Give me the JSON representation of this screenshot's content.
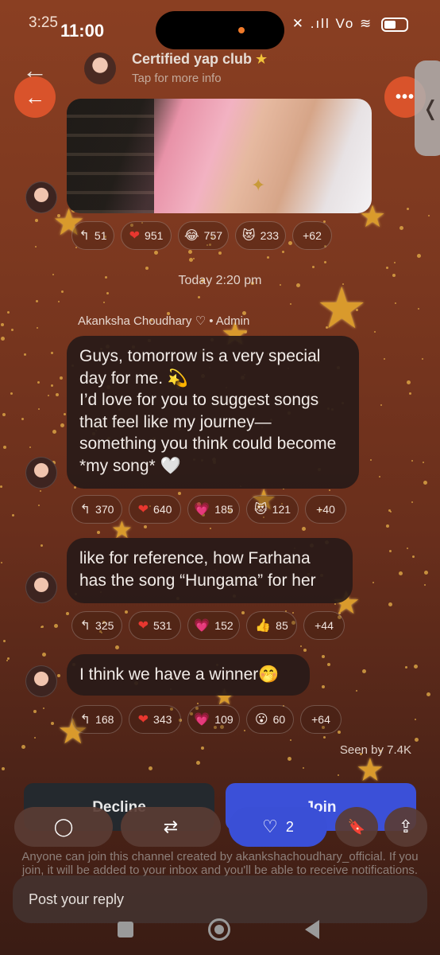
{
  "status_bar": {
    "small_time": "3:25",
    "time": "11:00",
    "icons": "✕ .ıll Vo ≋",
    "battery": "43"
  },
  "header": {
    "title": "Certified yap club",
    "title_star": "★",
    "subtitle": "Tap for more info",
    "back_glyph": "←",
    "more_glyph": "•••",
    "side_glyph": "❬"
  },
  "messages": [
    {
      "id": "media",
      "reactions": [
        {
          "icon": "reply-icon",
          "glyph": "↰",
          "count": "51"
        },
        {
          "icon": "red-heart-icon",
          "glyph": "❤",
          "count": "951"
        },
        {
          "icon": "laughing-icon",
          "glyph": "😂",
          "count": "757"
        },
        {
          "icon": "heart-eyes-cat-icon",
          "glyph": "😻",
          "count": "233"
        },
        {
          "icon": "",
          "glyph": "",
          "count": "+62"
        }
      ]
    },
    {
      "id": "m1",
      "text": "Guys, tomorrow is a very special day for me. 💫\nI’d love for you to suggest songs that feel like my journey—something you think could become *my song* 🤍",
      "reactions": [
        {
          "icon": "reply-icon",
          "glyph": "↰",
          "count": "370"
        },
        {
          "icon": "red-heart-icon",
          "glyph": "❤",
          "count": "640"
        },
        {
          "icon": "pink-heart-icon",
          "glyph": "💗",
          "count": "185"
        },
        {
          "icon": "heart-eyes-cat-icon",
          "glyph": "😻",
          "count": "121"
        },
        {
          "icon": "",
          "glyph": "",
          "count": "+40"
        }
      ]
    },
    {
      "id": "m2",
      "text": "like for reference, how Farhana has the song “Hungama” for her",
      "reactions": [
        {
          "icon": "reply-icon",
          "glyph": "↰",
          "count": "325"
        },
        {
          "icon": "red-heart-icon",
          "glyph": "❤",
          "count": "531"
        },
        {
          "icon": "pink-heart-icon",
          "glyph": "💗",
          "count": "152"
        },
        {
          "icon": "thumbs-up-icon",
          "glyph": "👍",
          "count": "85"
        },
        {
          "icon": "",
          "glyph": "",
          "count": "+44"
        }
      ]
    },
    {
      "id": "m3",
      "text": "I think we have a winner🤭",
      "reactions": [
        {
          "icon": "reply-icon",
          "glyph": "↰",
          "count": "168"
        },
        {
          "icon": "red-heart-icon",
          "glyph": "❤",
          "count": "343"
        },
        {
          "icon": "pink-heart-icon",
          "glyph": "💗",
          "count": "109"
        },
        {
          "icon": "surprised-face-icon",
          "glyph": "😮",
          "count": "60"
        },
        {
          "icon": "",
          "glyph": "",
          "count": "+64"
        }
      ]
    }
  ],
  "timestamp": "Today 2:20 pm",
  "sender": "Akanksha Choudhary ♡ • Admin",
  "seen": "Seen by 7.4K",
  "actions": {
    "decline": "Decline",
    "join": "Join"
  },
  "toolbar": {
    "comment_glyph": "◯",
    "repost_glyph": "⇄",
    "like_glyph": "♡",
    "like_count": "2",
    "bookmark_glyph": "🔖",
    "share_glyph": "⇪"
  },
  "notice": "Anyone can join this channel created by akankshachoudhary_official. If you join, it will be added to your inbox and you'll be able to receive notifications.",
  "reply_placeholder": "Post your reply",
  "colors": {
    "accent_orange": "#d9532b",
    "join_blue": "#3b50d8",
    "heart_red": "#e8372f"
  }
}
